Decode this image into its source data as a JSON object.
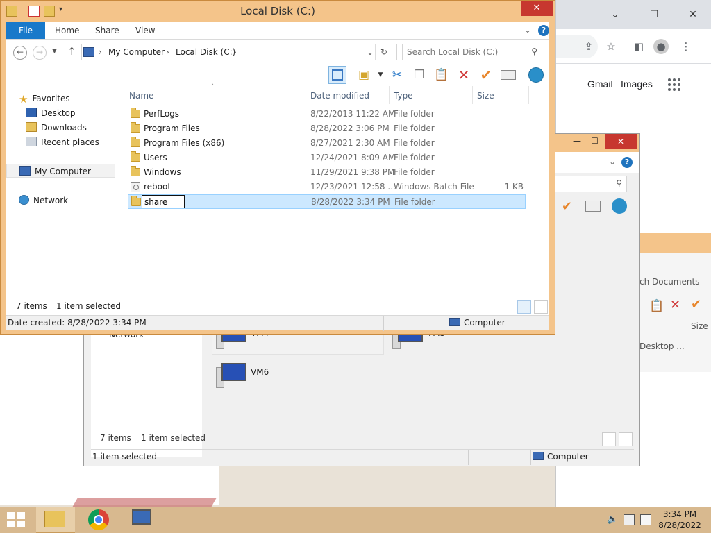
{
  "main_window": {
    "title": "Local Disk (C:)",
    "controls": {
      "minimize": "—",
      "maximize": "☐",
      "close": "✕"
    },
    "ribbon_tabs": [
      "File",
      "Home",
      "Share",
      "View"
    ],
    "nav": {
      "back": "←",
      "forward": "→",
      "up": "↑",
      "breadcrumb": [
        "My Computer",
        "Local Disk (C:)"
      ],
      "search_placeholder": "Search Local Disk (C:)"
    },
    "nav_pane": {
      "favorites": "Favorites",
      "desktop": "Desktop",
      "downloads": "Downloads",
      "recent": "Recent places",
      "computer": "My Computer",
      "network": "Network"
    },
    "columns": {
      "name": "Name",
      "date": "Date modified",
      "type": "Type",
      "size": "Size"
    },
    "files": [
      {
        "name": "PerfLogs",
        "date": "8/22/2013 11:22 AM",
        "type": "File folder",
        "size": ""
      },
      {
        "name": "Program Files",
        "date": "8/28/2022 3:06 PM",
        "type": "File folder",
        "size": ""
      },
      {
        "name": "Program Files (x86)",
        "date": "8/27/2021 2:30 AM",
        "type": "File folder",
        "size": ""
      },
      {
        "name": "Users",
        "date": "12/24/2021 8:09 AM",
        "type": "File folder",
        "size": ""
      },
      {
        "name": "Windows",
        "date": "11/29/2021 9:38 PM",
        "type": "File folder",
        "size": ""
      },
      {
        "name": "reboot",
        "date": "12/23/2021 12:58 ...",
        "type": "Windows Batch File",
        "size": "1 KB"
      },
      {
        "name": "share",
        "date": "8/28/2022 3:34 PM",
        "type": "File folder",
        "size": ""
      }
    ],
    "status": {
      "items": "7 items",
      "selected": "1 item selected"
    },
    "details": {
      "created": "Date created: 8/28/2022 3:34 PM",
      "location": "Computer"
    }
  },
  "second_window": {
    "vms": [
      "VM4",
      "VM5",
      "VM6"
    ],
    "status": {
      "items": "7 items",
      "selected": "1 item selected",
      "bottom": "1 item selected",
      "location": "Computer"
    },
    "network_partial": "Network"
  },
  "third_window": {
    "search_partial": "ch Documents",
    "size_header": "Size",
    "desktop_partial": "Desktop ..."
  },
  "chrome": {
    "gmail": "Gmail",
    "images": "Images"
  },
  "taskbar": {
    "time": "3:34 PM",
    "date": "8/28/2022"
  },
  "colors": {
    "title_bar": "#f4c48a",
    "accent": "#1979ca",
    "selection": "#cce8ff",
    "taskbar": "#d8b98f"
  }
}
